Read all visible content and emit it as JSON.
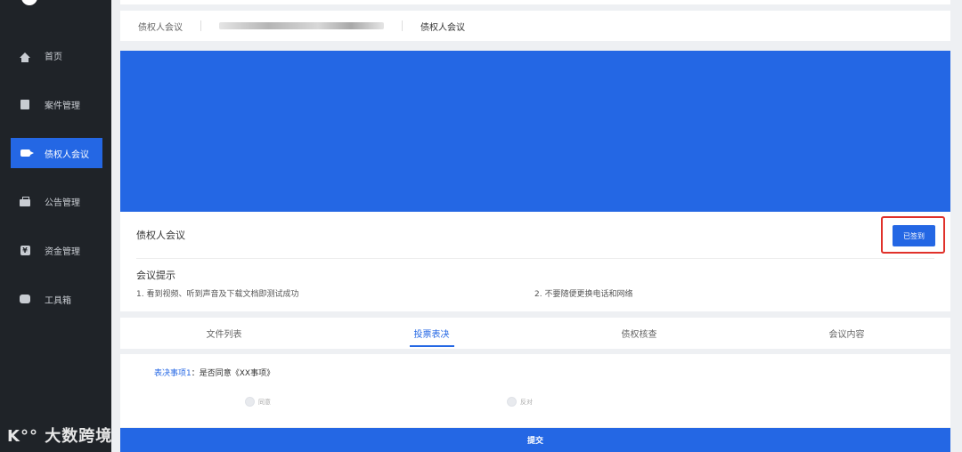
{
  "sidebar": {
    "items": [
      {
        "label": "首页",
        "icon": "home-icon"
      },
      {
        "label": "案件管理",
        "icon": "case-icon"
      },
      {
        "label": "债权人会议",
        "icon": "video-camera-icon",
        "active": true
      },
      {
        "label": "公告管理",
        "icon": "briefcase-icon"
      },
      {
        "label": "资金管理",
        "icon": "yen-icon"
      },
      {
        "label": "工具箱",
        "icon": "toolbox-icon"
      }
    ]
  },
  "watermark": "大数跨境",
  "breadcrumb": {
    "first": "债权人会议",
    "current": "债权人会议"
  },
  "meeting": {
    "title": "债权人会议",
    "signed_label": "已签到",
    "tips_title": "会议提示",
    "tip1": "1. 看到视频、听到声音及下载文档即测试成功",
    "tip2": "2. 不要随便更换电话和网络"
  },
  "tabs": [
    {
      "label": "文件列表"
    },
    {
      "label": "投票表决",
      "active": true
    },
    {
      "label": "债权核查"
    },
    {
      "label": "会议内容"
    }
  ],
  "vote": {
    "item_label": "表决事项1",
    "item_text": "：是否同意《XX事项》",
    "option_agree": "同意",
    "option_oppose": "反对"
  },
  "submit_label": "提交",
  "colors": {
    "accent": "#2467e4",
    "sidebar_bg": "#1f2328",
    "highlight_border": "#e0312a"
  }
}
